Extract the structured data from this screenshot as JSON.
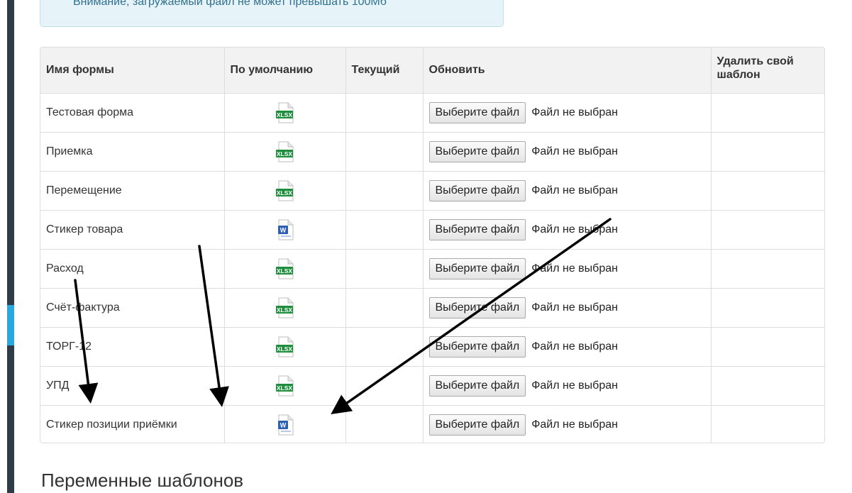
{
  "alert": {
    "text": "Внимание, загружаемый файл не может превышать 100Мб"
  },
  "table": {
    "headers": {
      "name": "Имя формы",
      "default": "По умолчанию",
      "current": "Текущий",
      "update": "Обновить",
      "delete": "Удалить свой шаблон"
    },
    "rows": [
      {
        "name": "Тестовая форма",
        "icon": "xlsx-file-icon"
      },
      {
        "name": "Приемка",
        "icon": "xlsx-file-icon"
      },
      {
        "name": "Перемещение",
        "icon": "xlsx-file-icon"
      },
      {
        "name": "Стикер товара",
        "icon": "word-file-icon"
      },
      {
        "name": "Расход",
        "icon": "xlsx-file-icon"
      },
      {
        "name": "Счёт-фактура",
        "icon": "xlsx-file-icon"
      },
      {
        "name": "ТОРГ-12",
        "icon": "xlsx-file-icon"
      },
      {
        "name": "УПД",
        "icon": "xlsx-file-icon"
      },
      {
        "name": "Стикер позиции приёмки",
        "icon": "word-file-icon"
      }
    ],
    "file_button_label": "Выберите файл",
    "file_status": "Файл не выбран",
    "xlsx_icon_label": "XLSX",
    "word_icon_label": "W"
  },
  "section": {
    "title": "Переменные шаблонов"
  },
  "colors": {
    "sidebar": "#2f3b46",
    "sidebar_accent": "#29a8e0",
    "alert_bg": "#e6f3f9",
    "alert_text": "#31708f",
    "xlsx_green": "#1e8e3e",
    "word_blue": "#2f5fb3",
    "annotation_arrow": "#000000"
  }
}
